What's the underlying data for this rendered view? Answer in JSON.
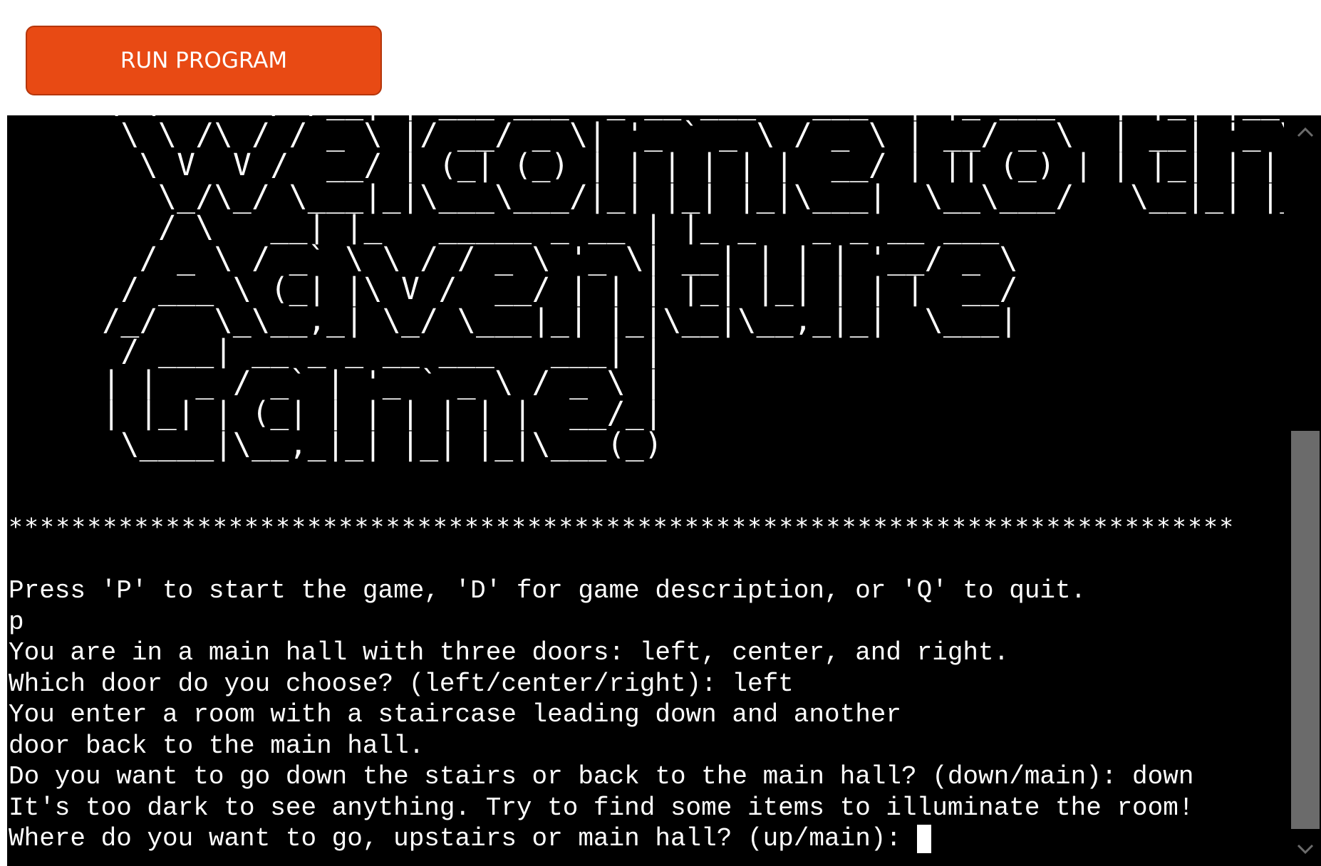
{
  "toolbar": {
    "run_label": "RUN PROGRAM"
  },
  "terminal": {
    "ascii_banner": [
      "     \\ \\      / /__| | ___ ___  _ __ ___   ___  | |_ ___   | |_| |__   ___",
      "      \\ \\ /\\ / / _ \\ |/ __/ _ \\| '_ ` _ \\ / _ \\ | __/ _ \\  | __| '_ \\ / _ \\",
      "       \\ V  V /  __/ | (_| (_) | | | | | |  __/ | || (_) | | |_| | | |  __/",
      "        \\_/\\_/ \\___|_|\\___\\___/|_| |_| |_|\\___|  \\__\\___/   \\__|_| |_|\\___|",
      "        / \\   __| |_   _____ _ __ | |_ _   _ _ __ ___",
      "       / _ \\ / _` \\ \\ / / _ \\ '_ \\| __| | | | '__/ _ \\",
      "      / ___ \\ (_| |\\ V /  __/ | | | |_| |_| | | |  __/",
      "     /_/   \\_\\__,_| \\_/ \\___|_| |_|\\__|\\__,_|_|  \\___|",
      "      / ___| __ _ _ __ ___   ___| |",
      "     | |  _ / _` | '_ ` _ \\ / _ \\ |",
      "     | |_| | (_| | | | | | |  __/_|",
      "      \\____|\\__,_|_| |_| |_|\\___(_)"
    ],
    "separator": "******************************************************************************",
    "lines": [
      "Press 'P' to start the game, 'D' for game description, or 'Q' to quit.",
      "p",
      "You are in a main hall with three doors: left, center, and right.",
      "Which door do you choose? (left/center/right): left",
      "You enter a room with a staircase leading down and another",
      "door back to the main hall.",
      "Do you want to go down the stairs or back to the main hall? (down/main): down",
      "It's too dark to see anything. Try to find some items to illuminate the room!",
      "Where do you want to go, upstairs or main hall? (up/main): "
    ]
  },
  "colors": {
    "button_bg": "#e84a14",
    "terminal_bg": "#000000",
    "terminal_fg": "#ffffff",
    "scroll_thumb": "#6b6b6b"
  },
  "icons": {
    "scroll_up": "chevron-up-icon",
    "scroll_down": "chevron-down-icon"
  }
}
